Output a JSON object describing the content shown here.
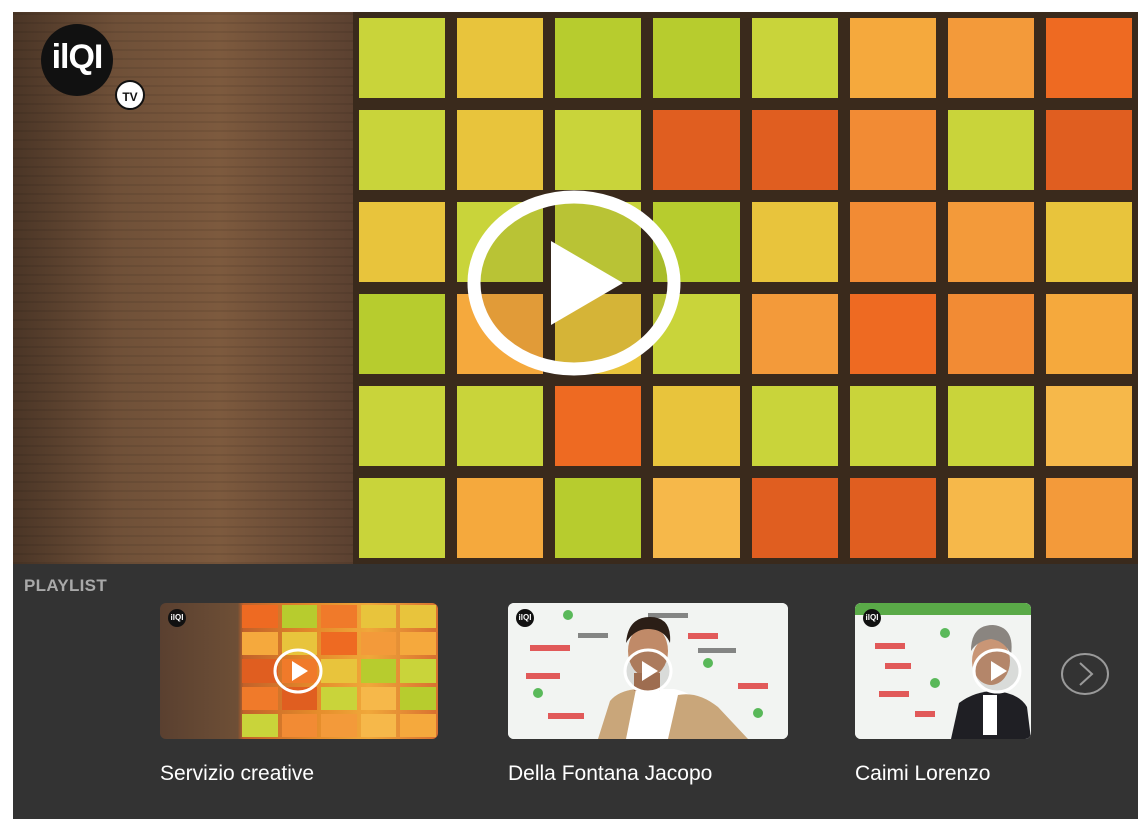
{
  "player": {
    "logo_text": "ilQI",
    "logo_badge": "TV",
    "icons": {
      "play": "play-circle-icon"
    }
  },
  "playlist": {
    "title": "PLAYLIST",
    "items": [
      {
        "title": "Servizio creative",
        "thumb_logo": "ilQI"
      },
      {
        "title": "Della Fontana Jacopo",
        "thumb_logo": "ilQI"
      },
      {
        "title": "Caimi Lorenzo",
        "thumb_logo": "ilQI"
      }
    ],
    "next_icon": "chevron-right-circle-icon"
  },
  "colors": {
    "playlist_bg": "#333333",
    "playlist_title": "#a9a9a9",
    "item_title": "#ffffff"
  }
}
